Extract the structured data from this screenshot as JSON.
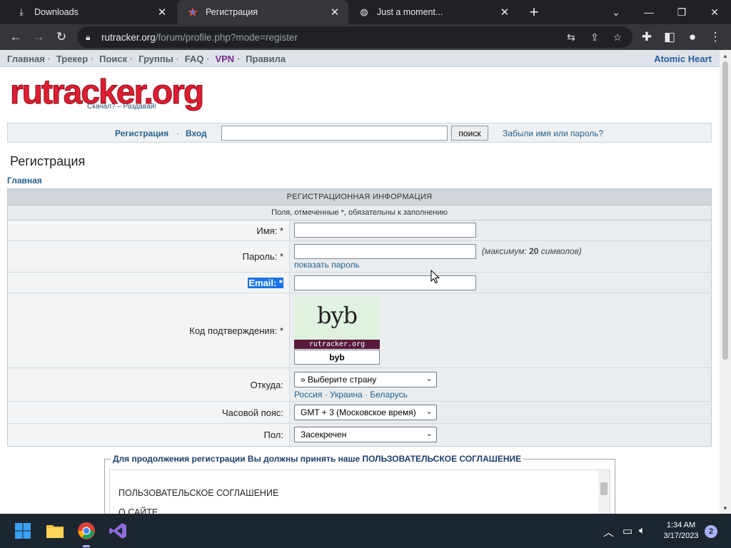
{
  "browser": {
    "tabs": [
      {
        "title": "Downloads",
        "icon": "download-icon",
        "active": false
      },
      {
        "title": "Регистрация",
        "icon": "rutracker-favicon",
        "active": true
      },
      {
        "title": "Just a moment...",
        "icon": "globe-icon",
        "active": false
      }
    ],
    "url_host": "rutracker.org",
    "url_path": "/forum/profile.php?mode=register"
  },
  "site": {
    "nav": [
      "Главная",
      "Трекер",
      "Поиск",
      "Группы",
      "FAQ",
      "VPN",
      "Правила"
    ],
    "ad_link": "Atomic Heart",
    "logo_text": "rutracker.org",
    "logo_slogan": "Скачал? – Раздавай!",
    "login": {
      "register": "Регистрация",
      "separator": "·",
      "enter": "Вход",
      "search_button": "поиск",
      "forgot": "Забыли имя или пароль?"
    },
    "page_title": "Регистрация",
    "breadcrumb": "Главная"
  },
  "form": {
    "header": "РЕГИСТРАЦИОННАЯ ИНФОРМАЦИЯ",
    "required_note": "Поля, отмеченные *, обязательны к заполнению",
    "name_label": "Имя: *",
    "password_label": "Пароль: *",
    "password_hint_prefix": "(максимум: ",
    "password_hint_max": "20",
    "password_hint_suffix": " символов)",
    "show_password": "показать пароль",
    "email_label": "Email: *",
    "captcha_label": "Код подтверждения: *",
    "captcha_text": "byb",
    "captcha_brand": "rutracker.org",
    "captcha_value": "byb",
    "country_label": "Откуда:",
    "country_value": "» Выберите страну",
    "country_links": "Россия · Украина · Беларусь",
    "timezone_label": "Часовой пояс:",
    "timezone_value": "GMT + 3 (Московское время)",
    "gender_label": "Пол:",
    "gender_value": "Засекречен"
  },
  "agreement": {
    "legend": "Для продолжения регистрации Вы должны принять наше ПОЛЬЗОВАТЕЛЬСКОЕ СОГЛАШЕНИЕ",
    "line1": "ПОЛЬЗОВАТЕЛЬСКОЕ СОГЛАШЕНИЕ",
    "line2": "О САЙТЕ"
  },
  "taskbar": {
    "time": "1:34 AM",
    "date": "3/17/2023",
    "notifications": "2"
  }
}
